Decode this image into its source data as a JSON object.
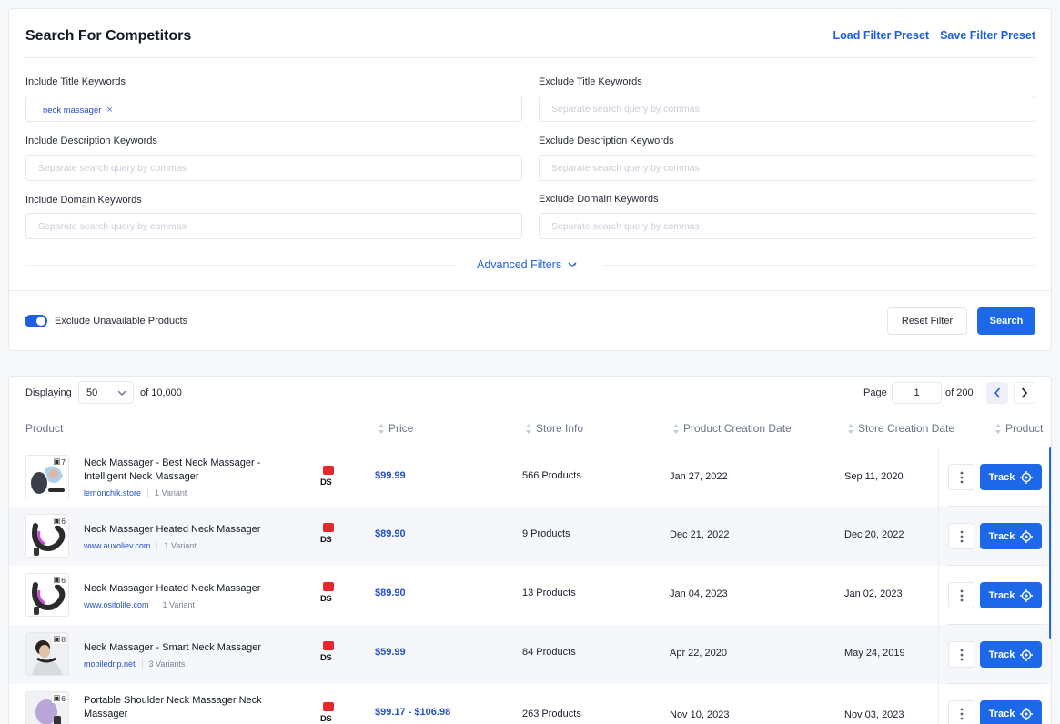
{
  "search": {
    "title": "Search For Competitors",
    "load_preset": "Load Filter Preset",
    "save_preset": "Save Filter Preset",
    "include_title_label": "Include Title Keywords",
    "include_title_chip": "neck massager",
    "exclude_title_label": "Exclude Title Keywords",
    "include_desc_label": "Include Description Keywords",
    "exclude_desc_label": "Exclude Description Keywords",
    "include_domain_label": "Include Domain Keywords",
    "exclude_domain_label": "Exclude Domain Keywords",
    "placeholder": "Separate search query by commas",
    "advanced": "Advanced Filters",
    "exclude_unavailable": "Exclude Unavailable Products",
    "exclude_unavailable_on": true,
    "reset": "Reset Filter",
    "search": "Search"
  },
  "results": {
    "displaying_label": "Displaying",
    "per_page": "50",
    "of_total": "of 10,000",
    "page_label": "Page",
    "page": "1",
    "of_pages": "of 200",
    "columns": [
      "Product",
      "Price",
      "Store Info",
      "Product Creation Date",
      "Store Creation Date",
      "Product"
    ],
    "rows": [
      {
        "title": "Neck Massager - Best Neck Massager - Intelligent Neck Massager",
        "domain": "lemonchik.store",
        "variants": "1 Variant",
        "images": "7",
        "badge": "DS",
        "price": "$99.99",
        "store": "566 Products",
        "product_date": "Jan 27, 2022",
        "store_date": "Sep 11, 2020",
        "track": "Track"
      },
      {
        "title": "Neck Massager Heated Neck Massager",
        "domain": "www.auxoliev.com",
        "variants": "1 Variant",
        "images": "6",
        "badge": "DS",
        "price": "$89.90",
        "store": "9 Products",
        "product_date": "Dec 21, 2022",
        "store_date": "Dec 20, 2022",
        "track": "Track"
      },
      {
        "title": "Neck Massager Heated Neck Massager",
        "domain": "www.ositolife.com",
        "variants": "1 Variant",
        "images": "6",
        "badge": "DS",
        "price": "$89.90",
        "store": "13 Products",
        "product_date": "Jan 04, 2023",
        "store_date": "Jan 02, 2023",
        "track": "Track"
      },
      {
        "title": "Neck Massager - Smart Neck Massager",
        "domain": "mobiledrip.net",
        "variants": "3 Variants",
        "images": "8",
        "badge": "DS",
        "price": "$59.99",
        "store": "84 Products",
        "product_date": "Apr 22, 2020",
        "store_date": "May 24, 2019",
        "track": "Track"
      },
      {
        "title": "Portable Shoulder Neck Massager Neck Massager",
        "domain": "",
        "variants": "",
        "images": "6",
        "badge": "DS",
        "price": "$99.17 - $106.98",
        "store": "263 Products",
        "product_date": "Nov 10, 2023",
        "store_date": "Nov 03, 2023",
        "track": "Track"
      }
    ]
  },
  "colors": {
    "accent": "#1d68e8",
    "link": "#1d5fe0",
    "badge_red": "#e8262b"
  }
}
